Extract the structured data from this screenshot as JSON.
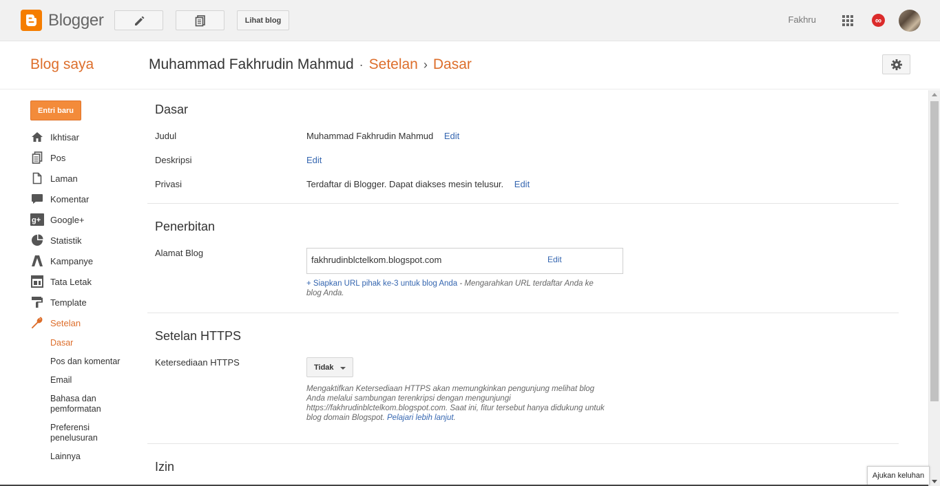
{
  "topbar": {
    "brand": "Blogger",
    "view_blog_label": "Lihat blog",
    "user_name": "Fakhru",
    "notif_symbol": "∞"
  },
  "header": {
    "my_blog": "Blog saya",
    "blog_title": "Muhammad Fakhrudin Mahmud",
    "crumb_sep1": "·",
    "crumb_settings": "Setelan",
    "crumb_sep2": "›",
    "crumb_basic": "Dasar"
  },
  "sidebar": {
    "new_post": "Entri baru",
    "items": [
      {
        "label": "Ikhtisar",
        "icon": "home-icon"
      },
      {
        "label": "Pos",
        "icon": "posts-icon"
      },
      {
        "label": "Laman",
        "icon": "pages-icon"
      },
      {
        "label": "Komentar",
        "icon": "comment-icon"
      },
      {
        "label": "Google+",
        "icon": "google-plus-icon"
      },
      {
        "label": "Statistik",
        "icon": "stats-icon"
      },
      {
        "label": "Kampanye",
        "icon": "campaign-icon"
      },
      {
        "label": "Tata Letak",
        "icon": "layout-icon"
      },
      {
        "label": "Template",
        "icon": "template-icon"
      },
      {
        "label": "Setelan",
        "icon": "wrench-icon"
      }
    ],
    "subitems": [
      {
        "label": "Dasar"
      },
      {
        "label": "Pos dan komentar"
      },
      {
        "label": "Email"
      },
      {
        "label": "Bahasa dan pemformatan"
      },
      {
        "label": "Preferensi penelusuran"
      },
      {
        "label": "Lainnya"
      }
    ]
  },
  "main": {
    "basic": {
      "title": "Dasar",
      "title_label": "Judul",
      "title_value": "Muhammad Fakhrudin Mahmud",
      "desc_label": "Deskripsi",
      "privacy_label": "Privasi",
      "privacy_value": "Terdaftar di Blogger. Dapat diakses mesin telusur.",
      "edit": "Edit"
    },
    "publishing": {
      "title": "Penerbitan",
      "address_label": "Alamat Blog",
      "address_value": "fakhrudinblctelkom.blogspot.com",
      "edit": "Edit",
      "setup_link": "+ Siapkan URL pihak ke-3 untuk blog Anda",
      "setup_desc_1": " - Mengarahkan URL terdaftar Anda ke",
      "setup_desc_2": "blog Anda."
    },
    "https": {
      "title": "Setelan HTTPS",
      "availability_label": "Ketersediaan HTTPS",
      "dropdown_value": "Tidak",
      "hint_line1": "Mengaktifkan Ketersediaan HTTPS akan memungkinkan pengunjung melihat blog",
      "hint_line2": "Anda melalui sambungan terenkripsi dengan mengunjungi",
      "hint_line3": "https://fakhrudinblctelkom.blogspot.com. Saat ini, fitur tersebut hanya didukung untuk",
      "hint_line4": "blog domain Blogspot. ",
      "learn_more": "Pelajari lebih lanjut",
      "hint_end": "."
    },
    "permissions": {
      "title": "Izin"
    }
  },
  "feedback": "Ajukan keluhan",
  "colors": {
    "accent": "#dd6e2b",
    "link": "#3566b0",
    "brand": "#f57d00"
  }
}
